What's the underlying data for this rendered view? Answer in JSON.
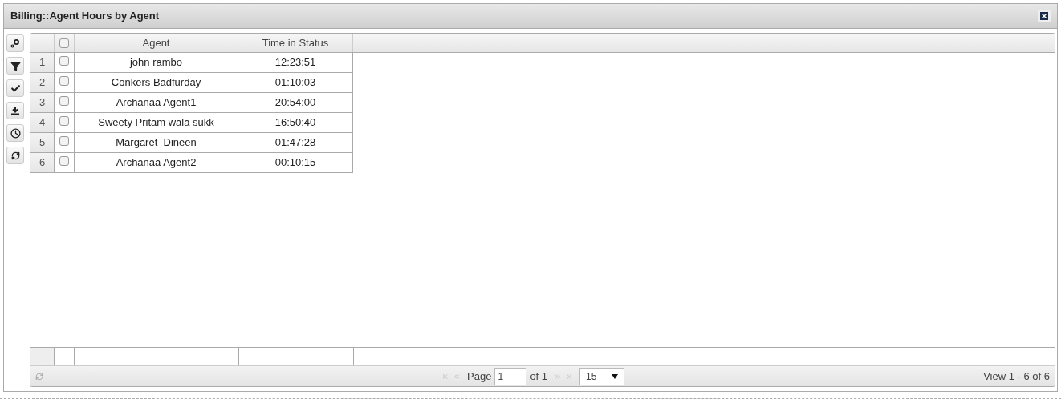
{
  "window": {
    "title": "Billing::Agent Hours by Agent"
  },
  "table": {
    "select_all": {
      "checked": false
    },
    "columns": [
      "Agent",
      "Time in Status"
    ],
    "rows": [
      {
        "number": "1",
        "checked": false,
        "agent": "john rambo",
        "time": "12:23:51"
      },
      {
        "number": "2",
        "checked": false,
        "agent": "Conkers Badfurday",
        "time": "01:10:03"
      },
      {
        "number": "3",
        "checked": false,
        "agent": "Archanaa Agent1",
        "time": "20:54:00"
      },
      {
        "number": "4",
        "checked": false,
        "agent": "Sweety Pritam wala sukk",
        "time": "16:50:40"
      },
      {
        "number": "5",
        "checked": false,
        "agent": "Margaret  Dineen",
        "time": "01:47:28"
      },
      {
        "number": "6",
        "checked": false,
        "agent": "Archanaa Agent2",
        "time": "00:10:15"
      }
    ]
  },
  "pager": {
    "page_label": "Page",
    "page": "1",
    "of_label": "of 1",
    "page_size": "15",
    "summary": "View 1 - 6 of 6"
  }
}
